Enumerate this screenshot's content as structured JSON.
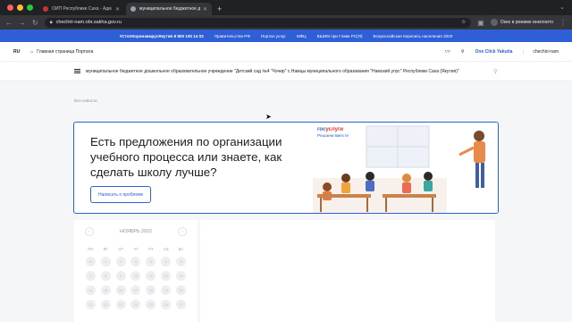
{
  "browser": {
    "tabs": [
      {
        "title": "ОИП Республики Саха - Адм",
        "favicon_color": "#c8342b",
        "active": false
      },
      {
        "title": "муниципальное бюджетное д",
        "favicon_color": "#9aa0a6",
        "active": true
      }
    ],
    "url": "chechiri-nam.obr.sakha.gov.ru",
    "incognito_label": "Окно в режиме инкогнито"
  },
  "bluebar": {
    "items": [
      "#СтопКоронавирусЯкутия 8 800 100 14 03",
      "Правительство РФ",
      "Портал услуг",
      "МФЦ",
      "ВШИМ при Главе РС(Я)",
      "Всероссийская перепись населения 2020"
    ]
  },
  "topnav": {
    "lang": "RU",
    "home_label": "Главная страница Портала",
    "one_click": "One Click Yakutia",
    "login": "chechiri-nam"
  },
  "org": {
    "name": "муниципальное бюджетное дошкольное образовательное учреждение \"Детский сад №4 \"Чэчир\" с.Намцы муниципального образования \"Намский улус\" Республики Саха (Якутия)\""
  },
  "breadcrumb": "Все новости",
  "banner": {
    "headline": "Есть предложения по организации учебного процесса или знаете, как сделать школу лучше?",
    "button": "Написать о проблеме",
    "gos_part1": "гос",
    "gos_part2": "услуги",
    "gos_sub": "Решаем вместе"
  },
  "calendar": {
    "month": "НОЯБРЬ 2022",
    "weekdays": [
      "ПН",
      "ВТ",
      "СР",
      "ЧТ",
      "ПТ",
      "СБ",
      "ВС"
    ],
    "days": [
      "31",
      "1",
      "2",
      "3",
      "4",
      "5",
      "6",
      "7",
      "8",
      "9",
      "10",
      "11",
      "12",
      "13",
      "14",
      "15",
      "16",
      "17",
      "18",
      "19",
      "20",
      "21",
      "22",
      "23",
      "24",
      "25",
      "26",
      "27"
    ]
  }
}
